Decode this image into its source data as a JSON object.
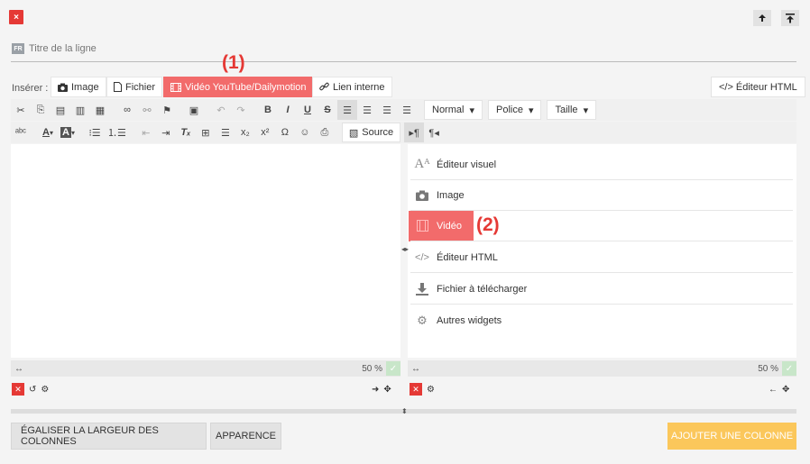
{
  "topbar": {
    "close_label": "×",
    "arrow_up": "↑",
    "arrow_top": "⤒"
  },
  "title_field": {
    "lang_badge": "FR",
    "placeholder": "Titre de la ligne"
  },
  "annotations": {
    "one": "(1)",
    "two": "(2)"
  },
  "insert": {
    "label": "Insérer :",
    "buttons": [
      {
        "label": "Image",
        "icon": "camera-icon"
      },
      {
        "label": "Fichier",
        "icon": "file-icon"
      },
      {
        "label": "Vidéo YouTube/Dailymotion",
        "icon": "film-icon"
      },
      {
        "label": "Lien interne",
        "icon": "link-icon"
      }
    ],
    "html_editor": "Éditeur HTML"
  },
  "toolbar1": {
    "icons": [
      "✂",
      "⎘",
      "📋",
      "📋",
      "📋",
      "∞",
      "⛓",
      "⚑",
      "🖼",
      "↶",
      "↷"
    ],
    "bold": "B",
    "italic": "I",
    "underline": "U",
    "strike": "S",
    "align_icons": [
      "≡",
      "≡",
      "≡",
      "≡"
    ],
    "format": "Normal",
    "font": "Police",
    "size": "Taille"
  },
  "toolbar2": {
    "source": "Source",
    "text_color": "A",
    "bg_color": "A",
    "ltr": "▸¶",
    "rtl": "¶◂"
  },
  "widgets": [
    {
      "label": "Éditeur visuel",
      "icon": "font-size-icon"
    },
    {
      "label": "Image",
      "icon": "camera-icon"
    },
    {
      "label": "Vidéo",
      "icon": "film-icon"
    },
    {
      "label": "Éditeur HTML",
      "icon": "code-icon"
    },
    {
      "label": "Fichier à télécharger",
      "icon": "download-icon"
    },
    {
      "label": "Autres widgets",
      "icon": "cogs-icon"
    }
  ],
  "left_col": {
    "width": "50 %",
    "width_pct": 50
  },
  "right_col": {
    "width": "50 %",
    "width_pct": 50
  },
  "bottom": {
    "equalize": "ÉGALISER LA LARGEUR DES COLONNES",
    "appearance": "APPARENCE",
    "add_column": "AJOUTER UNE COLONNE"
  },
  "colors": {
    "danger": "#e53935",
    "highlight": "#f26b6b",
    "accent": "#fbc75b",
    "success": "#c8e6c9"
  }
}
